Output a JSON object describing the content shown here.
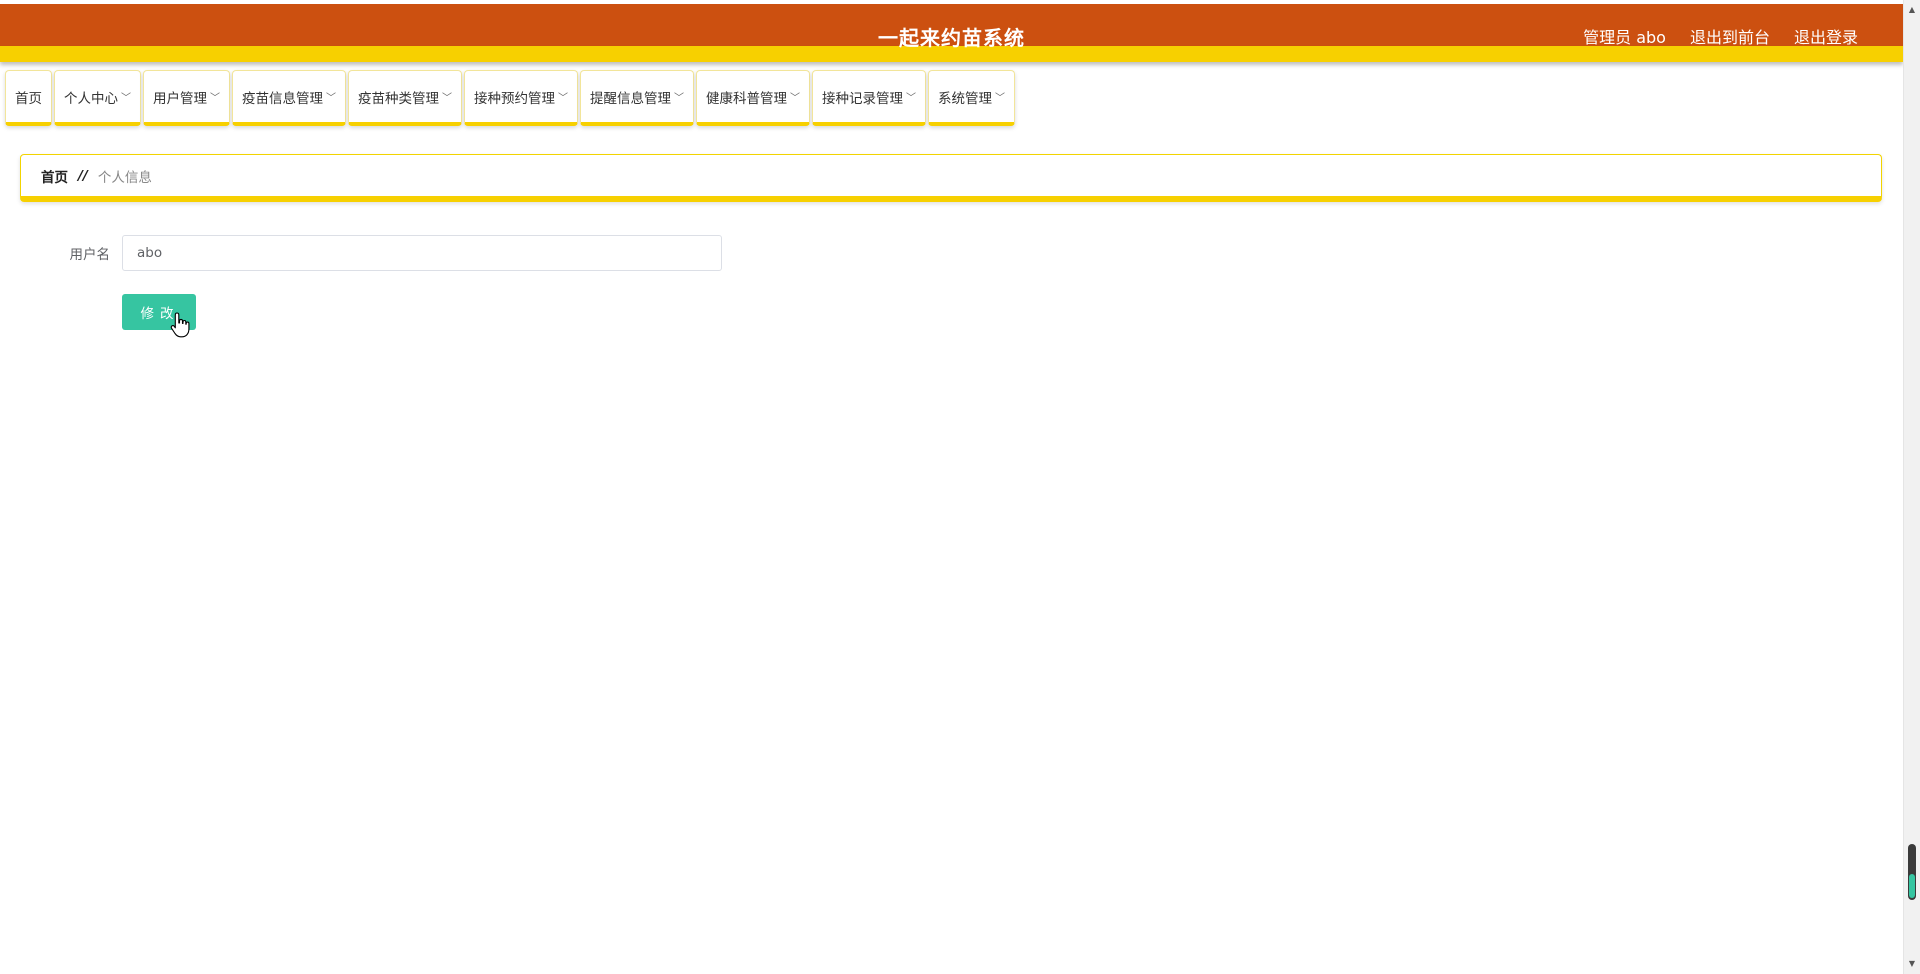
{
  "header": {
    "title": "一起来约苗系统",
    "links": [
      "管理员 abo",
      "退出到前台",
      "退出登录"
    ],
    "bg_color": "#cc5010",
    "stripe_color": "#f7d000"
  },
  "nav": {
    "items": [
      {
        "label": "首页",
        "has_dropdown": false
      },
      {
        "label": "个人中心",
        "has_dropdown": true
      },
      {
        "label": "用户管理",
        "has_dropdown": true
      },
      {
        "label": "疫苗信息管理",
        "has_dropdown": true
      },
      {
        "label": "疫苗种类管理",
        "has_dropdown": true
      },
      {
        "label": "接种预约管理",
        "has_dropdown": true
      },
      {
        "label": "提醒信息管理",
        "has_dropdown": true
      },
      {
        "label": "健康科普管理",
        "has_dropdown": true
      },
      {
        "label": "接种记录管理",
        "has_dropdown": true
      },
      {
        "label": "系统管理",
        "has_dropdown": true
      }
    ],
    "chevron_icon": "chevron-down-icon"
  },
  "breadcrumb": {
    "home": "首页",
    "separator": "//",
    "current": "个人信息"
  },
  "form": {
    "username_label": "用户名",
    "username_value": "abo",
    "submit_label": "修改",
    "button_color": "#36c5a1"
  }
}
